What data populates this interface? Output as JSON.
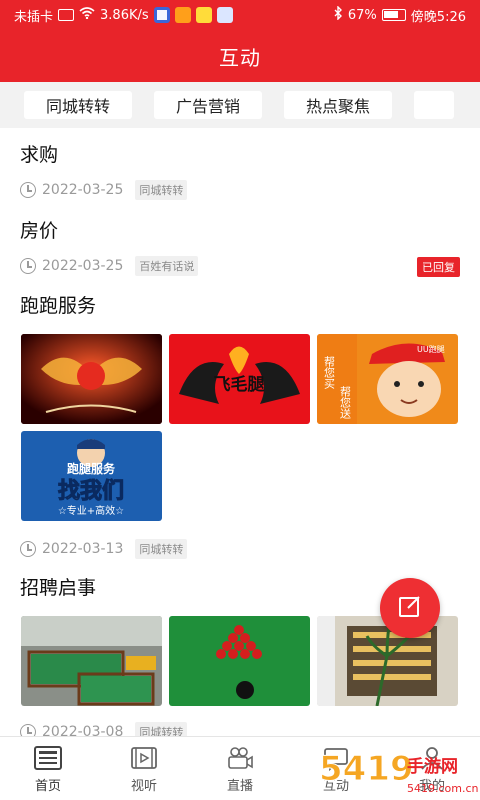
{
  "status_bar": {
    "carrier": "未插卡",
    "speed": "3.86K/s",
    "battery": "67%",
    "time": "傍晚5:26"
  },
  "header": {
    "title": "互动"
  },
  "tabs": [
    {
      "label": "同城转转"
    },
    {
      "label": "广告营销"
    },
    {
      "label": "热点聚焦"
    }
  ],
  "posts": [
    {
      "title": "求购",
      "date": "2022-03-25",
      "tag": "同城转转"
    },
    {
      "title": "房价",
      "date": "2022-03-25",
      "tag": "百姓有话说",
      "badge": "已回复"
    },
    {
      "title": "跑跑服务",
      "date": "2022-03-13",
      "tag": "同城转转",
      "image_texts": {
        "img2": "飞毛腿",
        "img3a": "帮您买",
        "img3b": "帮您送",
        "img3c": "UU跑腿",
        "img4a": "跑腿服务",
        "img4b": "找我们",
        "img4c": "☆专业+高效☆"
      }
    },
    {
      "title": "招聘启事",
      "date": "2022-03-08",
      "tag": "同城转转"
    }
  ],
  "bottom_nav": [
    {
      "label": "首页",
      "icon": "news-icon"
    },
    {
      "label": "视听",
      "icon": "video-icon"
    },
    {
      "label": "直播",
      "icon": "live-icon"
    },
    {
      "label": "互动",
      "icon": "chat-icon"
    },
    {
      "label": "我的",
      "icon": "user-icon"
    }
  ],
  "watermark": {
    "line1": "5419手游网",
    "line2": "5419.com.cn"
  },
  "colors": {
    "brand_red": "#e8242a",
    "grey_text": "#9a9a9a"
  }
}
